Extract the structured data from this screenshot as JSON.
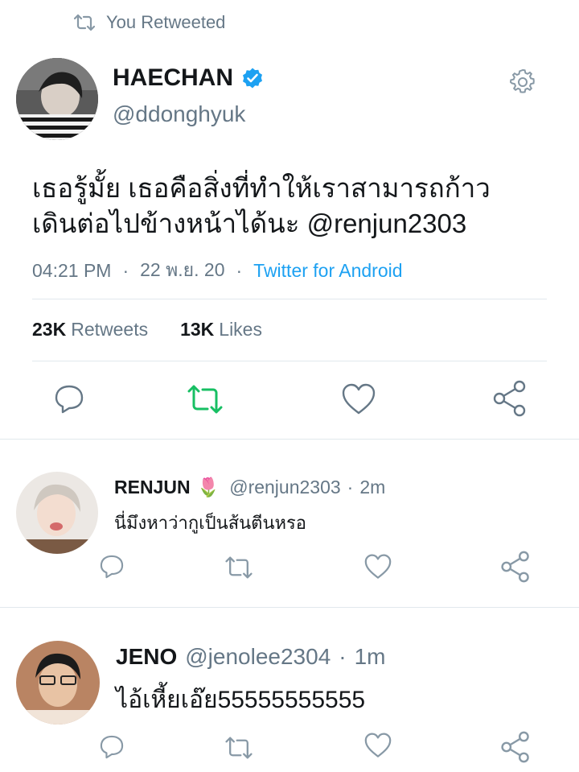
{
  "retweet_header": {
    "text": "You Retweeted"
  },
  "main_tweet": {
    "author_name": "HAECHAN",
    "author_handle": "@ddonghyuk",
    "text_line1": "เธอรู้มั้ย เธอคือสิ่งที่ทำให้เราสามารถก้าว",
    "text_line2": "เดินต่อไปข้างหน้าได้นะ @renjun2303",
    "time": "04:21 PM",
    "date": "22 พ.ย. 20",
    "source": "Twitter for Android",
    "retweets_count": "23K",
    "retweets_label": "Retweets",
    "likes_count": "13K",
    "likes_label": "Likes",
    "retweeted": true
  },
  "replies": [
    {
      "name": "RENJUN",
      "emoji": "🌷",
      "handle": "@renjun2303",
      "time": "2m",
      "text": "นี่มึงหาว่ากูเป็นส้นตีนหรอ"
    },
    {
      "name": "JENO",
      "handle": "@jenolee2304",
      "time": "1m",
      "text": "ไอ้เหี้ยเอ๊ย55555555555"
    }
  ],
  "colors": {
    "accent": "#1da1f2",
    "retweet_green": "#17bf63",
    "muted": "#657786",
    "divider": "#e1e8ed",
    "verified": "#1da1f2"
  },
  "separator": "·"
}
